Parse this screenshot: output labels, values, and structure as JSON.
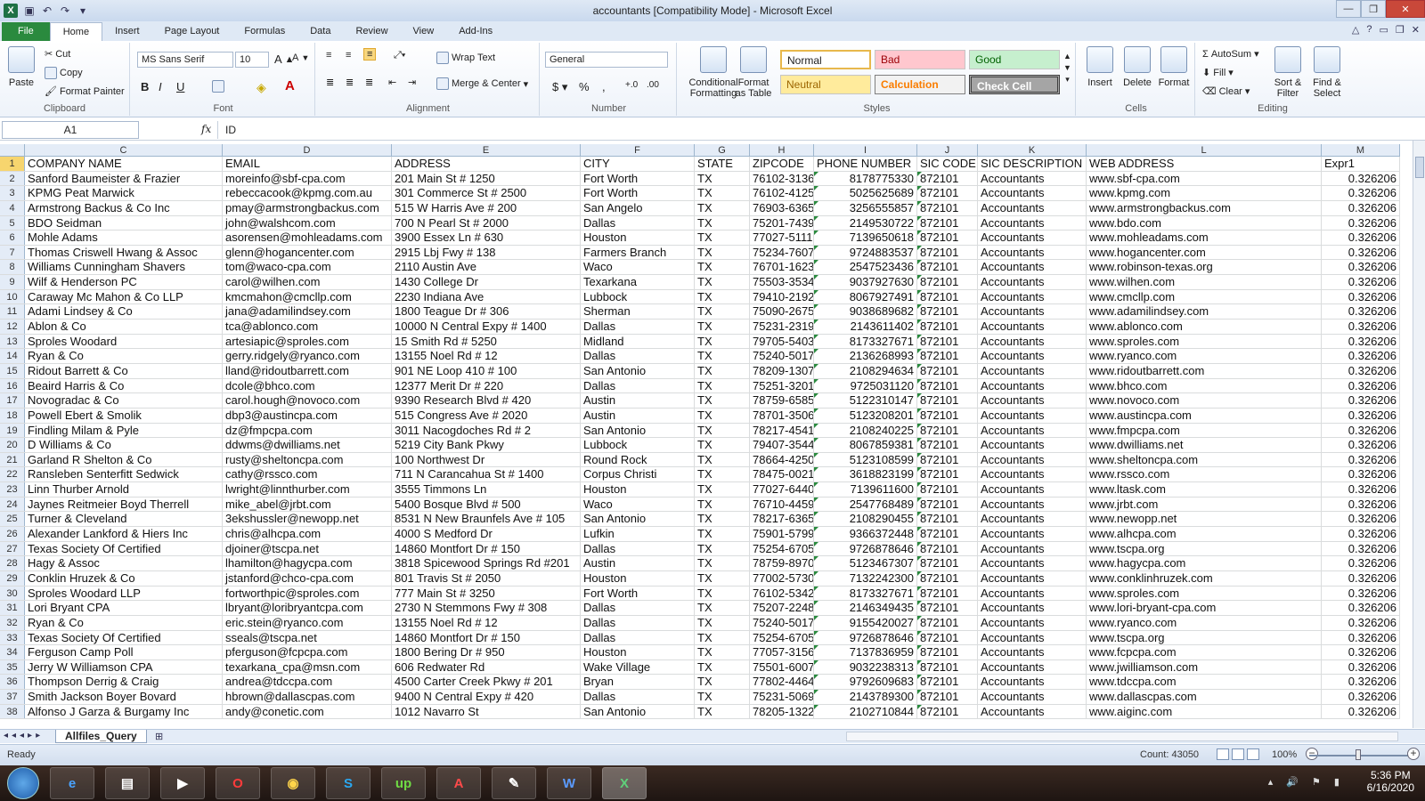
{
  "titlebar": {
    "title": "accountants  [Compatibility Mode] - Microsoft Excel"
  },
  "tabs": [
    "File",
    "Home",
    "Insert",
    "Page Layout",
    "Formulas",
    "Data",
    "Review",
    "View",
    "Add-Ins"
  ],
  "ribbon": {
    "clipboard": {
      "paste": "Paste",
      "cut": "Cut",
      "copy": "Copy",
      "format_painter": "Format Painter",
      "label": "Clipboard"
    },
    "font": {
      "name": "MS Sans Serif",
      "size": "10",
      "label": "Font"
    },
    "alignment": {
      "wrap_text": "Wrap Text",
      "merge_center": "Merge & Center",
      "label": "Alignment"
    },
    "number": {
      "format": "General",
      "label": "Number"
    },
    "styles": {
      "conditional": "Conditional Formatting",
      "format_table": "Format as Table",
      "normal": "Normal",
      "bad": "Bad",
      "good": "Good",
      "neutral": "Neutral",
      "calculation": "Calculation",
      "check_cell": "Check Cell",
      "label": "Styles"
    },
    "cells": {
      "insert": "Insert",
      "delete": "Delete",
      "format": "Format",
      "label": "Cells"
    },
    "editing": {
      "autosum": "AutoSum",
      "fill": "Fill",
      "clear": "Clear",
      "sort_filter": "Sort & Filter",
      "find_select": "Find & Select",
      "label": "Editing"
    }
  },
  "formula_bar": {
    "name_box": "A1",
    "fx": "fx",
    "formula": "ID"
  },
  "columns": [
    "C",
    "D",
    "E",
    "F",
    "G",
    "H",
    "I",
    "J",
    "K",
    "L",
    "M"
  ],
  "rows": [
    [
      "1",
      "COMPANY NAME",
      "EMAIL",
      "ADDRESS",
      "CITY",
      "STATE",
      "ZIPCODE",
      "PHONE NUMBER",
      "SIC CODE",
      "SIC DESCRIPTION",
      "WEB ADDRESS",
      "Expr1"
    ],
    [
      "2",
      "Sanford Baumeister & Frazier",
      "moreinfo@sbf-cpa.com",
      "201 Main St # 1250",
      "Fort Worth",
      "TX",
      "76102-3136",
      "8178775330",
      "872101",
      "Accountants",
      "www.sbf-cpa.com",
      "0.326206"
    ],
    [
      "3",
      "KPMG Peat Marwick",
      "rebeccacook@kpmg.com.au",
      "301 Commerce St # 2500",
      "Fort Worth",
      "TX",
      "76102-4125",
      "5025625689",
      "872101",
      "Accountants",
      "www.kpmg.com",
      "0.326206"
    ],
    [
      "4",
      "Armstrong Backus & Co Inc",
      "pmay@armstrongbackus.com",
      "515 W Harris Ave # 200",
      "San Angelo",
      "TX",
      "76903-6365",
      "3256555857",
      "872101",
      "Accountants",
      "www.armstrongbackus.com",
      "0.326206"
    ],
    [
      "5",
      "BDO Seidman",
      "john@walshcom.com",
      "700 N Pearl St # 2000",
      "Dallas",
      "TX",
      "75201-7439",
      "2149530722",
      "872101",
      "Accountants",
      "www.bdo.com",
      "0.326206"
    ],
    [
      "6",
      "Mohle Adams",
      "asorensen@mohleadams.com",
      "3900 Essex Ln # 630",
      "Houston",
      "TX",
      "77027-5111",
      "7139650618",
      "872101",
      "Accountants",
      "www.mohleadams.com",
      "0.326206"
    ],
    [
      "7",
      "Thomas Criswell Hwang & Assoc",
      "glenn@hogancenter.com",
      "2915 Lbj Fwy # 138",
      "Farmers Branch",
      "TX",
      "75234-7607",
      "9724883537",
      "872101",
      "Accountants",
      "www.hogancenter.com",
      "0.326206"
    ],
    [
      "8",
      "Williams Cunningham Shavers",
      "tom@waco-cpa.com",
      "2110 Austin Ave",
      "Waco",
      "TX",
      "76701-1623",
      "2547523436",
      "872101",
      "Accountants",
      "www.robinson-texas.org",
      "0.326206"
    ],
    [
      "9",
      "Wilf & Henderson PC",
      "carol@wilhen.com",
      "1430 College Dr",
      "Texarkana",
      "TX",
      "75503-3534",
      "9037927630",
      "872101",
      "Accountants",
      "www.wilhen.com",
      "0.326206"
    ],
    [
      "10",
      "Caraway Mc Mahon & Co LLP",
      "kmcmahon@cmcllp.com",
      "2230 Indiana Ave",
      "Lubbock",
      "TX",
      "79410-2192",
      "8067927491",
      "872101",
      "Accountants",
      "www.cmcllp.com",
      "0.326206"
    ],
    [
      "11",
      "Adami Lindsey & Co",
      "jana@adamilindsey.com",
      "1800 Teague Dr # 306",
      "Sherman",
      "TX",
      "75090-2675",
      "9038689682",
      "872101",
      "Accountants",
      "www.adamilindsey.com",
      "0.326206"
    ],
    [
      "12",
      "Ablon & Co",
      "tca@ablonco.com",
      "10000 N Central Expy # 1400",
      "Dallas",
      "TX",
      "75231-2319",
      "2143611402",
      "872101",
      "Accountants",
      "www.ablonco.com",
      "0.326206"
    ],
    [
      "13",
      "Sproles Woodard",
      "artesiapic@sproles.com",
      "15 Smith Rd # 5250",
      "Midland",
      "TX",
      "79705-5403",
      "8173327671",
      "872101",
      "Accountants",
      "www.sproles.com",
      "0.326206"
    ],
    [
      "14",
      "Ryan & Co",
      "gerry.ridgely@ryanco.com",
      "13155 Noel Rd # 12",
      "Dallas",
      "TX",
      "75240-5017",
      "2136268993",
      "872101",
      "Accountants",
      "www.ryanco.com",
      "0.326206"
    ],
    [
      "15",
      "Ridout Barrett & Co",
      "lland@ridoutbarrett.com",
      "901 NE Loop 410 # 100",
      "San Antonio",
      "TX",
      "78209-1307",
      "2108294634",
      "872101",
      "Accountants",
      "www.ridoutbarrett.com",
      "0.326206"
    ],
    [
      "16",
      "Beaird Harris & Co",
      "dcole@bhco.com",
      "12377 Merit Dr # 220",
      "Dallas",
      "TX",
      "75251-3201",
      "9725031120",
      "872101",
      "Accountants",
      "www.bhco.com",
      "0.326206"
    ],
    [
      "17",
      "Novogradac & Co",
      "carol.hough@novoco.com",
      "9390 Research Blvd # 420",
      "Austin",
      "TX",
      "78759-6585",
      "5122310147",
      "872101",
      "Accountants",
      "www.novoco.com",
      "0.326206"
    ],
    [
      "18",
      "Powell Ebert & Smolik",
      "dbp3@austincpa.com",
      "515 Congress Ave # 2020",
      "Austin",
      "TX",
      "78701-3506",
      "5123208201",
      "872101",
      "Accountants",
      "www.austincpa.com",
      "0.326206"
    ],
    [
      "19",
      "Findling Milam & Pyle",
      "dz@fmpcpa.com",
      "3011 Nacogdoches Rd # 2",
      "San Antonio",
      "TX",
      "78217-4541",
      "2108240225",
      "872101",
      "Accountants",
      "www.fmpcpa.com",
      "0.326206"
    ],
    [
      "20",
      "D Williams & Co",
      "ddwms@dwilliams.net",
      "5219 City Bank Pkwy",
      "Lubbock",
      "TX",
      "79407-3544",
      "8067859381",
      "872101",
      "Accountants",
      "www.dwilliams.net",
      "0.326206"
    ],
    [
      "21",
      "Garland R Shelton & Co",
      "rusty@sheltoncpa.com",
      "100 Northwest Dr",
      "Round Rock",
      "TX",
      "78664-4250",
      "5123108599",
      "872101",
      "Accountants",
      "www.sheltoncpa.com",
      "0.326206"
    ],
    [
      "22",
      "Ransleben Senterfitt Sedwick",
      "cathy@rssco.com",
      "711 N Carancahua St # 1400",
      "Corpus Christi",
      "TX",
      "78475-0021",
      "3618823199",
      "872101",
      "Accountants",
      "www.rssco.com",
      "0.326206"
    ],
    [
      "23",
      "Linn Thurber Arnold",
      "lwright@linnthurber.com",
      "3555 Timmons Ln",
      "Houston",
      "TX",
      "77027-6440",
      "7139611600",
      "872101",
      "Accountants",
      "www.ltask.com",
      "0.326206"
    ],
    [
      "24",
      "Jaynes Reitmeier Boyd Therrell",
      "mike_abel@jrbt.com",
      "5400 Bosque Blvd # 500",
      "Waco",
      "TX",
      "76710-4459",
      "2547768489",
      "872101",
      "Accountants",
      "www.jrbt.com",
      "0.326206"
    ],
    [
      "25",
      "Turner & Cleveland",
      "3ekshussler@newopp.net",
      "8531 N New Braunfels Ave # 105",
      "San Antonio",
      "TX",
      "78217-6365",
      "2108290455",
      "872101",
      "Accountants",
      "www.newopp.net",
      "0.326206"
    ],
    [
      "26",
      "Alexander Lankford & Hiers Inc",
      "chris@alhcpa.com",
      "4000 S Medford Dr",
      "Lufkin",
      "TX",
      "75901-5799",
      "9366372448",
      "872101",
      "Accountants",
      "www.alhcpa.com",
      "0.326206"
    ],
    [
      "27",
      "Texas Society Of Certified",
      "djoiner@tscpa.net",
      "14860 Montfort Dr # 150",
      "Dallas",
      "TX",
      "75254-6705",
      "9726878646",
      "872101",
      "Accountants",
      "www.tscpa.org",
      "0.326206"
    ],
    [
      "28",
      "Hagy & Assoc",
      "lhamilton@hagycpa.com",
      "3818 Spicewood Springs Rd #201",
      "Austin",
      "TX",
      "78759-8970",
      "5123467307",
      "872101",
      "Accountants",
      "www.hagycpa.com",
      "0.326206"
    ],
    [
      "29",
      "Conklin Hruzek & Co",
      "jstanford@chco-cpa.com",
      "801 Travis St # 2050",
      "Houston",
      "TX",
      "77002-5730",
      "7132242300",
      "872101",
      "Accountants",
      "www.conklinhruzek.com",
      "0.326206"
    ],
    [
      "30",
      "Sproles Woodard LLP",
      "fortworthpic@sproles.com",
      "777 Main St # 3250",
      "Fort Worth",
      "TX",
      "76102-5342",
      "8173327671",
      "872101",
      "Accountants",
      "www.sproles.com",
      "0.326206"
    ],
    [
      "31",
      "Lori Bryant CPA",
      "lbryant@loribryantcpa.com",
      "2730 N Stemmons Fwy # 308",
      "Dallas",
      "TX",
      "75207-2248",
      "2146349435",
      "872101",
      "Accountants",
      "www.lori-bryant-cpa.com",
      "0.326206"
    ],
    [
      "32",
      "Ryan & Co",
      "eric.stein@ryanco.com",
      "13155 Noel Rd # 12",
      "Dallas",
      "TX",
      "75240-5017",
      "9155420027",
      "872101",
      "Accountants",
      "www.ryanco.com",
      "0.326206"
    ],
    [
      "33",
      "Texas Society Of Certified",
      "sseals@tscpa.net",
      "14860 Montfort Dr # 150",
      "Dallas",
      "TX",
      "75254-6705",
      "9726878646",
      "872101",
      "Accountants",
      "www.tscpa.org",
      "0.326206"
    ],
    [
      "34",
      "Ferguson Camp Poll",
      "pferguson@fcpcpa.com",
      "1800 Bering Dr # 950",
      "Houston",
      "TX",
      "77057-3156",
      "7137836959",
      "872101",
      "Accountants",
      "www.fcpcpa.com",
      "0.326206"
    ],
    [
      "35",
      "Jerry W Williamson CPA",
      "texarkana_cpa@msn.com",
      "606 Redwater Rd",
      "Wake Village",
      "TX",
      "75501-6007",
      "9032238313",
      "872101",
      "Accountants",
      "www.jwilliamson.com",
      "0.326206"
    ],
    [
      "36",
      "Thompson Derrig & Craig",
      "andrea@tdccpa.com",
      "4500 Carter Creek Pkwy # 201",
      "Bryan",
      "TX",
      "77802-4464",
      "9792609683",
      "872101",
      "Accountants",
      "www.tdccpa.com",
      "0.326206"
    ],
    [
      "37",
      "Smith Jackson Boyer Bovard",
      "hbrown@dallascpas.com",
      "9400 N Central Expy # 420",
      "Dallas",
      "TX",
      "75231-5069",
      "2143789300",
      "872101",
      "Accountants",
      "www.dallascpas.com",
      "0.326206"
    ],
    [
      "38",
      "Alfonso J Garza & Burgamy Inc",
      "andy@conetic.com",
      "1012 Navarro St",
      "San Antonio",
      "TX",
      "78205-1322",
      "2102710844",
      "872101",
      "Accountants",
      "www.aiginc.com",
      "0.326206"
    ]
  ],
  "sheet_tab": "Allfiles_Query",
  "status": {
    "ready": "Ready",
    "count": "Count: 43050",
    "zoom": "100%"
  },
  "taskbar": {
    "time": "5:36 PM",
    "date": "6/16/2020"
  }
}
